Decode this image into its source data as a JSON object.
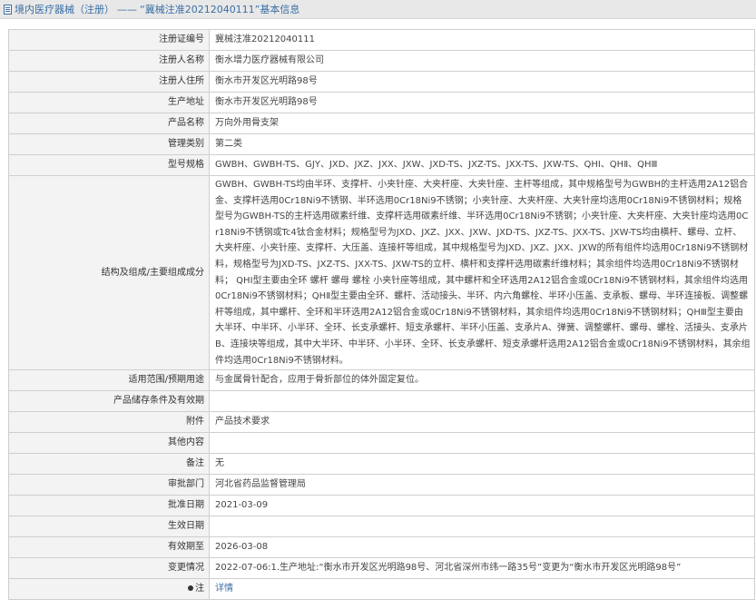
{
  "header": {
    "prefix": "境内医疗器械（注册）",
    "separator": "——",
    "title": "“冀械注准20212040111”基本信息"
  },
  "fields": [
    {
      "key": "注册证编号",
      "value": "冀械注准20212040111"
    },
    {
      "key": "注册人名称",
      "value": "衡水增力医疗器械有限公司"
    },
    {
      "key": "注册人住所",
      "value": "衡水市开发区光明路98号"
    },
    {
      "key": "生产地址",
      "value": "衡水市开发区光明路98号"
    },
    {
      "key": "产品名称",
      "value": "万向外用骨支架"
    },
    {
      "key": "管理类别",
      "value": "第二类"
    },
    {
      "key": "型号规格",
      "value": "GWBH、GWBH-TS、GJY、JXD、JXZ、JXX、JXW、JXD-TS、JXZ-TS、JXX-TS、JXW-TS、QHⅠ、QHⅡ、QHⅢ"
    },
    {
      "key": "结构及组成/主要组成成分",
      "value": "GWBH、GWBH-TS均由半环、支撑杆、小夹针座、大夹杆座、大夹针座、主杆等组成，其中规格型号为GWBH的主杆选用2A12铝合金、支撑杆选用0Cr18Ni9不锈钢、半环选用0Cr18Ni9不锈钢；小夹针座、大夹杆座、大夹针座均选用0Cr18Ni9不锈钢材料；规格型号为GWBH-TS的主杆选用碳素纤维、支撑杆选用碳素纤维、半环选用0Cr18Ni9不锈钢；小夹针座、大夹杆座、大夹针座均选用0Cr18Ni9不锈钢或Tc4钛合金材料；规格型号为JXD、JXZ、JXX、JXW、JXD-TS、JXZ-TS、JXX-TS、JXW-TS均由横杆、螺母、立杆、大夹杆座、小夹针座、支撑杆、大压盖、连接杆等组成，其中规格型号为JXD、JXZ、JXX、JXW的所有组件均选用0Cr18Ni9不锈钢材料，规格型号为JXD-TS、JXZ-TS、JXX-TS、JXW-TS的立杆、横杆和支撑杆选用碳素纤维材料；其余组件均选用0Cr18Ni9不锈钢材料； QHⅠ型主要由全环 螺杆 螺母 螺栓 小夹针座等组成，其中螺杆和全环选用2A12铝合金或0Cr18Ni9不锈钢材料，其余组件均选用0Cr18Ni9不锈钢材料；QHⅡ型主要由全环、螺杆、活动接头、半环、内六角螺栓、半环小压盖、支承板、螺母、半环连接板、调整螺杆等组成，其中螺杆、全环和半环选用2A12铝合金或0Cr18Ni9不锈钢材料，其余组件均选用0Cr18Ni9不锈钢材料；QHⅢ型主要由大半环、中半环、小半环、全环、长支承螺杆、短支承螺杆、半环小压盖、支承片A、弹簧、调整螺杆、螺母、螺栓、活接头、支承片B、连接块等组成，其中大半环、中半环、小半环、全环、长支承螺杆、短支承螺杆选用2A12铝合金或0Cr18Ni9不锈钢材料，其余组件均选用0Cr18Ni9不锈钢材料。"
    },
    {
      "key": "适用范围/预期用途",
      "value": "与金属骨针配合，应用于骨折部位的体外固定复位。"
    },
    {
      "key": "产品储存条件及有效期",
      "value": ""
    },
    {
      "key": "附件",
      "value": "产品技术要求"
    },
    {
      "key": "其他内容",
      "value": ""
    },
    {
      "key": "备注",
      "value": "无"
    },
    {
      "key": "审批部门",
      "value": "河北省药品监督管理局"
    },
    {
      "key": "批准日期",
      "value": "2021-03-09"
    },
    {
      "key": "生效日期",
      "value": ""
    },
    {
      "key": "有效期至",
      "value": "2026-03-08"
    },
    {
      "key": "变更情况",
      "value": "2022-07-06:1.生产地址:“衡水市开发区光明路98号、河北省深州市纬一路35号”变更为“衡水市开发区光明路98号”"
    }
  ],
  "footer_row": {
    "key": "注",
    "icon": "dot-icon",
    "link_label": "详情"
  },
  "colors": {
    "link": "#3a6ea5",
    "label_bg": "#f3f3f3",
    "border": "#cfcfcf",
    "titlebar_bg": "#e8e8e8"
  }
}
